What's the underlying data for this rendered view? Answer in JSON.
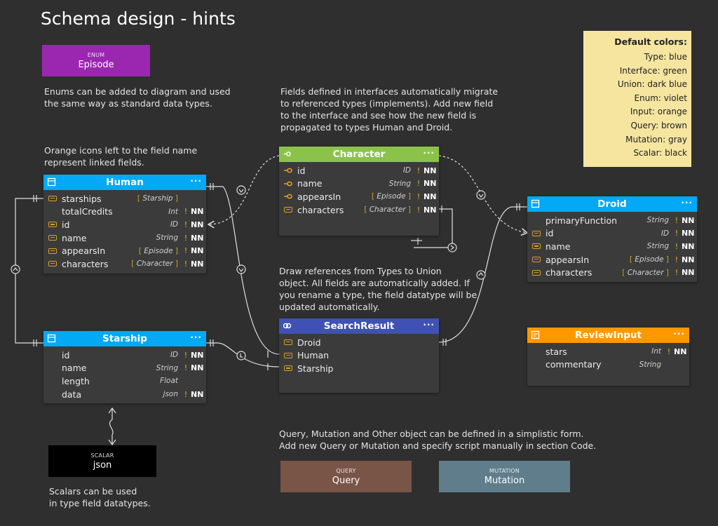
{
  "title": "Schema design - hints",
  "notes": {
    "enums": "Enums can be added to diagram and used\nthe same way as standard data types.",
    "interfaces": "Fields defined in interfaces automatically migrate\nto referenced types (implements). Add new field\nto the interface and see how the new field is\npropagated to types Human and Droid.",
    "linked": "Orange icons left to the field name\nrepresent linked fields.",
    "union": "Draw references from Types to Union\nobject. All fields are automatically added. If\nyou rename a type, the field datatype will be\nupdated automatically.",
    "scalars": "Scalars can be used\nin type field datatypes.",
    "query": "Query, Mutation and Other object can be defined in a simplistic form.\nAdd new Query or Mutation and specify script manually in section Code."
  },
  "simple_boxes": {
    "episode": {
      "kind": "ENUM",
      "name": "Episode",
      "color": "#9b27b0"
    },
    "json": {
      "kind": "SCALAR",
      "name": "json",
      "color": "#000000"
    },
    "query": {
      "kind": "QUERY",
      "name": "Query",
      "color": "#795548"
    },
    "mutation": {
      "kind": "MUTATION",
      "name": "Mutation",
      "color": "#607d8b"
    }
  },
  "legend": {
    "heading": "Default colors:",
    "items": [
      "Type: blue",
      "Interface: green",
      "Union: dark blue",
      "Enum: violet",
      "Input: orange",
      "Query: brown",
      "Mutation: gray",
      "Scalar: black"
    ]
  },
  "entities": {
    "human": {
      "name": "Human",
      "color": "#03a9f4",
      "menu": "···",
      "fields": [
        {
          "icon": "link",
          "name": "starships",
          "type": "Starship",
          "list": true,
          "bang": false,
          "nn": ""
        },
        {
          "icon": "none",
          "name": "totalCredits",
          "type": "Int",
          "list": false,
          "bang": true,
          "nn": "NN"
        },
        {
          "icon": "link",
          "name": "id",
          "type": "ID",
          "list": false,
          "bang": true,
          "nn": "NN"
        },
        {
          "icon": "link",
          "name": "name",
          "type": "String",
          "list": false,
          "bang": true,
          "nn": "NN"
        },
        {
          "icon": "link",
          "name": "appearsIn",
          "type": "Episode",
          "list": true,
          "bang": true,
          "nn": "NN"
        },
        {
          "icon": "link",
          "name": "characters",
          "type": "Character",
          "list": true,
          "bang": true,
          "nn": "NN"
        }
      ]
    },
    "starship": {
      "name": "Starship",
      "color": "#03a9f4",
      "menu": "···",
      "fields": [
        {
          "icon": "none",
          "name": "id",
          "type": "ID",
          "list": false,
          "bang": true,
          "nn": "NN"
        },
        {
          "icon": "none",
          "name": "name",
          "type": "String",
          "list": false,
          "bang": true,
          "nn": "NN"
        },
        {
          "icon": "none",
          "name": "length",
          "type": "Float",
          "list": false,
          "bang": false,
          "nn": ""
        },
        {
          "icon": "none",
          "name": "data",
          "type": "json",
          "list": false,
          "bang": true,
          "nn": "NN"
        }
      ]
    },
    "character": {
      "name": "Character",
      "color": "#8bc34a",
      "menu": "···",
      "fields": [
        {
          "icon": "impl",
          "name": "id",
          "type": "ID",
          "list": false,
          "bang": true,
          "nn": "NN"
        },
        {
          "icon": "impl",
          "name": "name",
          "type": "String",
          "list": false,
          "bang": true,
          "nn": "NN"
        },
        {
          "icon": "impl",
          "name": "appearsIn",
          "type": "Episode",
          "list": true,
          "bang": true,
          "nn": "NN"
        },
        {
          "icon": "link",
          "name": "characters",
          "type": "Character",
          "list": true,
          "bang": true,
          "nn": "NN"
        }
      ]
    },
    "droid": {
      "name": "Droid",
      "color": "#03a9f4",
      "menu": "···",
      "fields": [
        {
          "icon": "none",
          "name": "primaryFunction",
          "type": "String",
          "list": false,
          "bang": true,
          "nn": "NN"
        },
        {
          "icon": "link",
          "name": "id",
          "type": "ID",
          "list": false,
          "bang": true,
          "nn": "NN"
        },
        {
          "icon": "link",
          "name": "name",
          "type": "String",
          "list": false,
          "bang": true,
          "nn": "NN"
        },
        {
          "icon": "link",
          "name": "appearsIn",
          "type": "Episode",
          "list": true,
          "bang": true,
          "nn": "NN"
        },
        {
          "icon": "link",
          "name": "characters",
          "type": "Character",
          "list": true,
          "bang": true,
          "nn": "NN"
        }
      ]
    },
    "searchresult": {
      "name": "SearchResult",
      "color": "#3f51b5",
      "menu": "···",
      "fields": [
        {
          "icon": "link",
          "name": "Droid",
          "type": "",
          "list": false,
          "bang": false,
          "nn": ""
        },
        {
          "icon": "link",
          "name": "Human",
          "type": "",
          "list": false,
          "bang": false,
          "nn": ""
        },
        {
          "icon": "link",
          "name": "Starship",
          "type": "",
          "list": false,
          "bang": false,
          "nn": ""
        }
      ]
    },
    "reviewinput": {
      "name": "ReviewInput",
      "color": "#ff9800",
      "menu": "···",
      "fields": [
        {
          "icon": "none",
          "name": "stars",
          "type": "Int",
          "list": false,
          "bang": true,
          "nn": "NN"
        },
        {
          "icon": "none",
          "name": "commentary",
          "type": "String",
          "list": false,
          "bang": false,
          "nn": ""
        }
      ]
    }
  }
}
